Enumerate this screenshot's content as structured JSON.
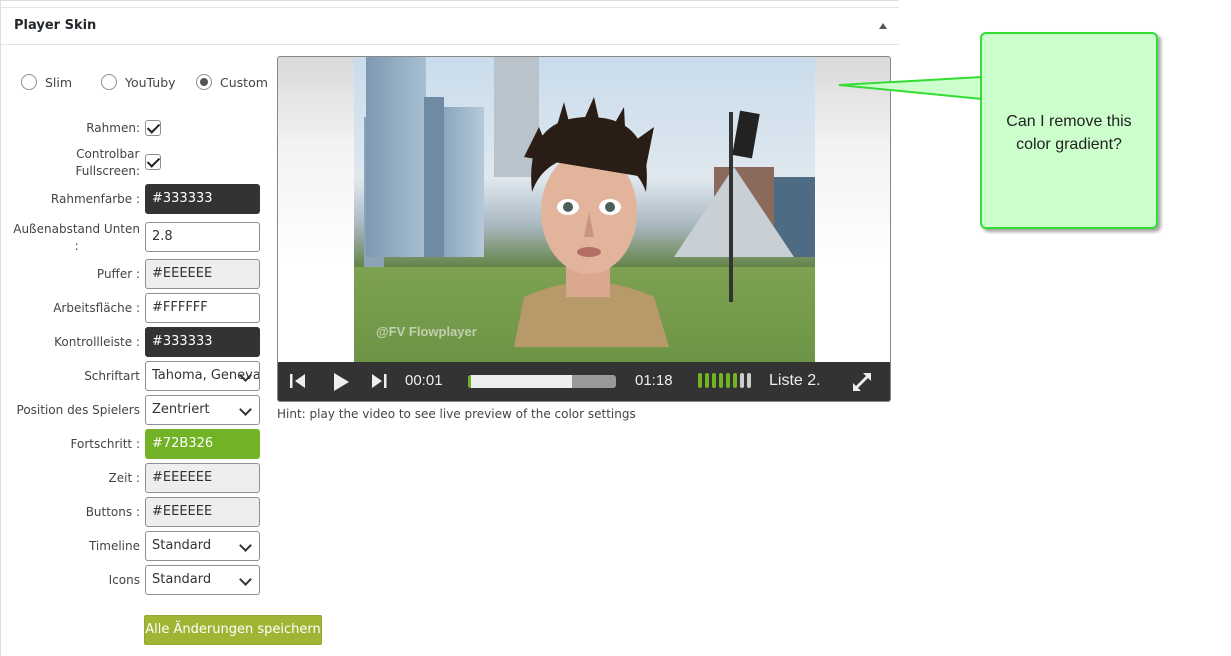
{
  "panel": {
    "title": "Player Skin"
  },
  "skin_options": [
    {
      "label": "Slim",
      "selected": false
    },
    {
      "label": "YouTuby",
      "selected": false
    },
    {
      "label": "Custom",
      "selected": true
    }
  ],
  "settings": {
    "rahmen_label": "Rahmen:",
    "rahmen_checked": true,
    "controlbar_label_1": "Controlbar",
    "controlbar_label_2": "Fullscreen:",
    "controlbar_checked": true,
    "rahmenfarbe_label": "Rahmenfarbe :",
    "rahmenfarbe_value": "#333333",
    "aussenabstand_label_1": "Außenabstand Unten",
    "aussenabstand_label_2": ":",
    "aussenabstand_value": "2.8",
    "puffer_label": "Puffer :",
    "puffer_value": "#EEEEEE",
    "arbeitsflaeche_label": "Arbeitsfläche :",
    "arbeitsflaeche_value": "#FFFFFF",
    "kontrollleiste_label": "Kontrollleiste :",
    "kontrollleiste_value": "#333333",
    "schriftart_label": "Schriftart",
    "schriftart_value": "Tahoma, Geneva",
    "position_label": "Position des Spielers",
    "position_value": "Zentriert",
    "fortschritt_label": "Fortschritt :",
    "fortschritt_value": "#72B326",
    "zeit_label": "Zeit :",
    "zeit_value": "#EEEEEE",
    "buttons_label": "Buttons :",
    "buttons_value": "#EEEEEE",
    "timeline_label": "Timeline",
    "timeline_value": "Standard",
    "icons_label": "Icons",
    "icons_value": "Standard"
  },
  "colors": {
    "dark": "#333333",
    "light": "#EEEEEE",
    "white": "#FFFFFF",
    "progress": "#72B326",
    "save_button": "#a0b534",
    "callout_bg": "#ccffcc",
    "callout_border": "#33dd33"
  },
  "player": {
    "watermark": "@FV Flowplayer",
    "current_time": "00:01",
    "duration": "01:18",
    "progress_fraction": 0.02,
    "buffer_fraction": 0.7,
    "volume_level": 0.75,
    "playlist_label": "Liste 2.",
    "icons": [
      "prev-icon",
      "play-icon",
      "next-icon",
      "fullscreen-icon"
    ]
  },
  "hint": "Hint: play the video to see live preview of the color settings",
  "save_label": "Alle Änderungen speichern",
  "callout": {
    "text": "Can I remove this color gradient?"
  }
}
